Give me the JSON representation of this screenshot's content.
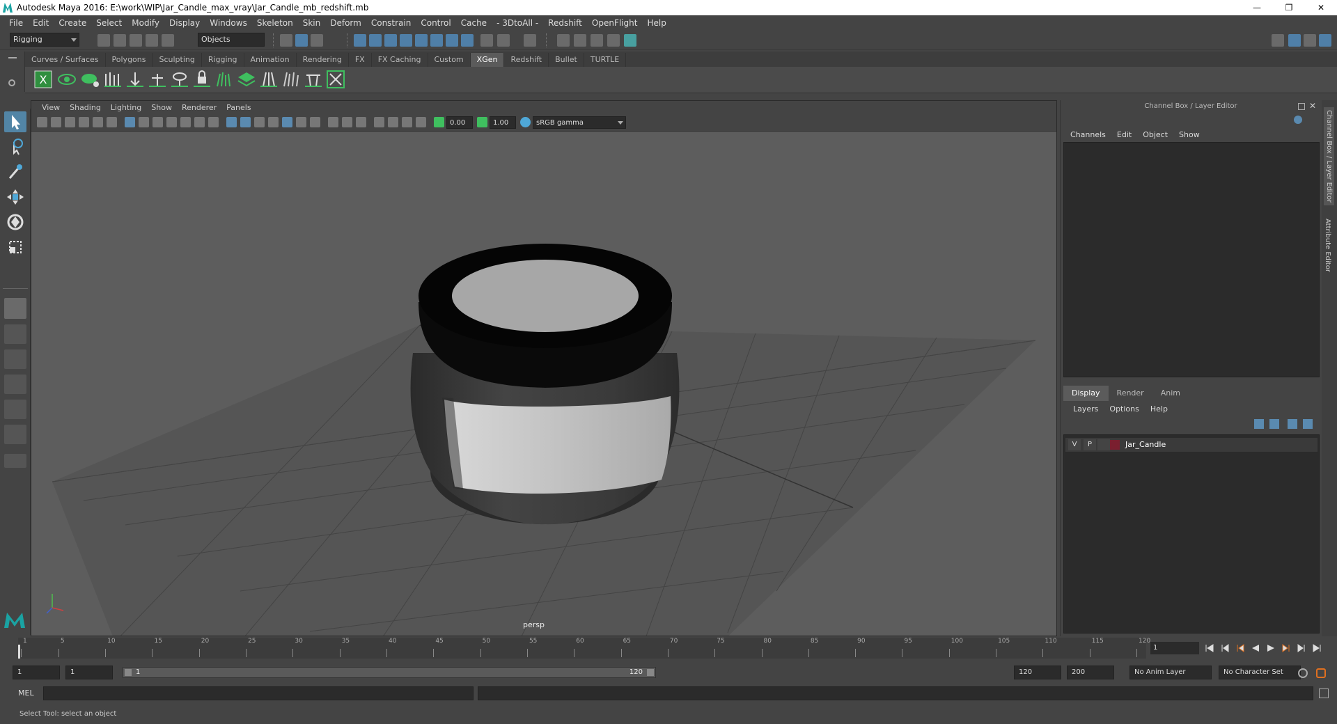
{
  "window": {
    "title": "Autodesk Maya 2016: E:\\work\\WIP\\Jar_Candle_max_vray\\Jar_Candle_mb_redshift.mb",
    "minimize": "—",
    "restore": "❐",
    "close": "✕"
  },
  "menu": [
    "File",
    "Edit",
    "Create",
    "Select",
    "Modify",
    "Display",
    "Windows",
    "Skeleton",
    "Skin",
    "Deform",
    "Constrain",
    "Control",
    "Cache",
    "- 3DtoAll -",
    "Redshift",
    "OpenFlight",
    "Help"
  ],
  "statusline": {
    "menuset": "Rigging",
    "select_mode": "Objects"
  },
  "shelf_tabs": [
    "Curves / Surfaces",
    "Polygons",
    "Sculpting",
    "Rigging",
    "Animation",
    "Rendering",
    "FX",
    "FX Caching",
    "Custom",
    "XGen",
    "Redshift",
    "Bullet",
    "TURTLE"
  ],
  "shelf_active": "XGen",
  "viewport": {
    "menu": [
      "View",
      "Shading",
      "Lighting",
      "Show",
      "Renderer",
      "Panels"
    ],
    "exposure": "0.00",
    "gamma": "1.00",
    "color_space": "sRGB gamma",
    "camera": "persp"
  },
  "channel_box": {
    "title": "Channel Box / Layer Editor",
    "menu": [
      "Channels",
      "Edit",
      "Object",
      "Show"
    ]
  },
  "layer_editor": {
    "tabs": [
      "Display",
      "Render",
      "Anim"
    ],
    "active_tab": "Display",
    "menu": [
      "Layers",
      "Options",
      "Help"
    ],
    "layers": [
      {
        "visible": "V",
        "playback": "P",
        "name": "Jar_Candle",
        "color": "#7a1f2f"
      }
    ]
  },
  "side_tabs": [
    "Channel Box / Layer Editor",
    "Attribute Editor"
  ],
  "timeline": {
    "ticks": [
      1,
      5,
      10,
      15,
      20,
      25,
      30,
      35,
      40,
      45,
      50,
      55,
      60,
      65,
      70,
      75,
      80,
      85,
      90,
      95,
      100,
      105,
      110,
      115,
      120
    ],
    "current_frame": "1"
  },
  "range": {
    "start": "1",
    "playback_start": "1",
    "bar_start": "1",
    "bar_end": "120",
    "playback_end": "120",
    "end": "200",
    "anim_layer": "No Anim Layer",
    "character_set": "No Character Set"
  },
  "command": {
    "language": "MEL"
  },
  "help_line": "Select Tool: select an object"
}
